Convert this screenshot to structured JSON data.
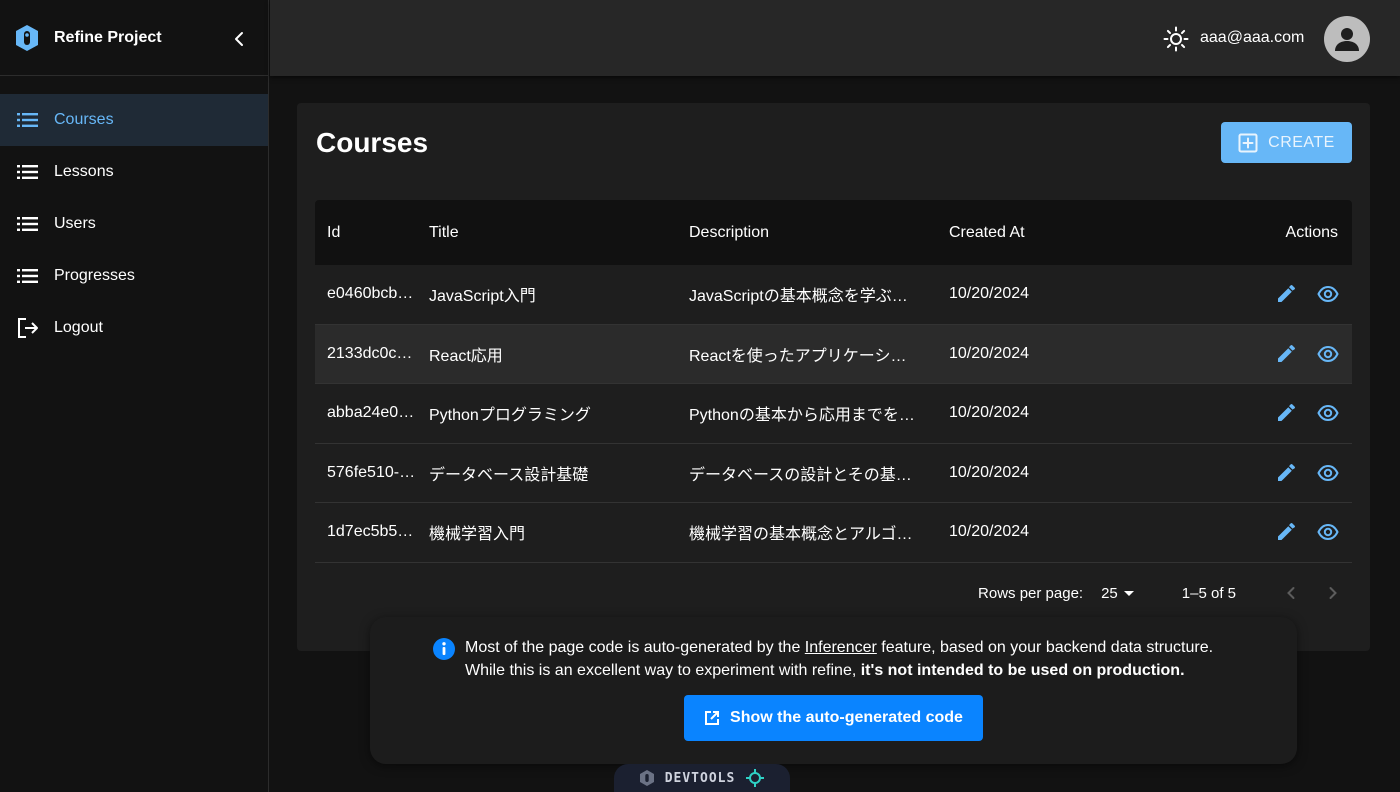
{
  "app": {
    "title": "Refine Project"
  },
  "sidebar": {
    "items": [
      {
        "label": "Courses",
        "icon": "list-icon",
        "active": true
      },
      {
        "label": "Lessons",
        "icon": "list-icon"
      },
      {
        "label": "Users",
        "icon": "list-icon"
      },
      {
        "label": "Progresses",
        "icon": "list-icon"
      },
      {
        "label": "Logout",
        "icon": "logout-icon"
      }
    ]
  },
  "header": {
    "user_email": "aaa@aaa.com"
  },
  "page": {
    "title": "Courses",
    "create_label": "CREATE"
  },
  "table": {
    "columns": [
      "Id",
      "Title",
      "Description",
      "Created At",
      "Actions"
    ],
    "rows": [
      {
        "id": "e0460bcb…",
        "title": "JavaScript入門",
        "description": "JavaScriptの基本概念を学ぶ…",
        "created_at": "10/20/2024"
      },
      {
        "id": "2133dc0c…",
        "title": "React応用",
        "description": "Reactを使ったアプリケーシ…",
        "created_at": "10/20/2024"
      },
      {
        "id": "abba24e0…",
        "title": "Pythonプログラミング",
        "description": "Pythonの基本から応用までを…",
        "created_at": "10/20/2024"
      },
      {
        "id": "576fe510-…",
        "title": "データベース設計基礎",
        "description": "データベースの設計とその基…",
        "created_at": "10/20/2024"
      },
      {
        "id": "1d7ec5b5…",
        "title": "機械学習入門",
        "description": "機械学習の基本概念とアルゴ…",
        "created_at": "10/20/2024"
      }
    ]
  },
  "pagination": {
    "rows_per_page_label": "Rows per page:",
    "rows_per_page": "25",
    "range": "1–5 of 5"
  },
  "banner": {
    "line1_pre": "Most of the page code is auto-generated by the ",
    "line1_link": "Inferencer",
    "line1_post": " feature, based on your backend data structure.",
    "line2_pre": "While this is an excellent way to experiment with refine, ",
    "line2_bold": "it's not intended to be used on production.",
    "button_label": "Show the auto-generated code"
  },
  "devtools": {
    "label": "DEVTOOLS"
  },
  "colors": {
    "accent": "#67b7f7",
    "primary_button": "#0a84ff",
    "header_bg": "#272727",
    "card_bg": "#1e1e1e"
  }
}
